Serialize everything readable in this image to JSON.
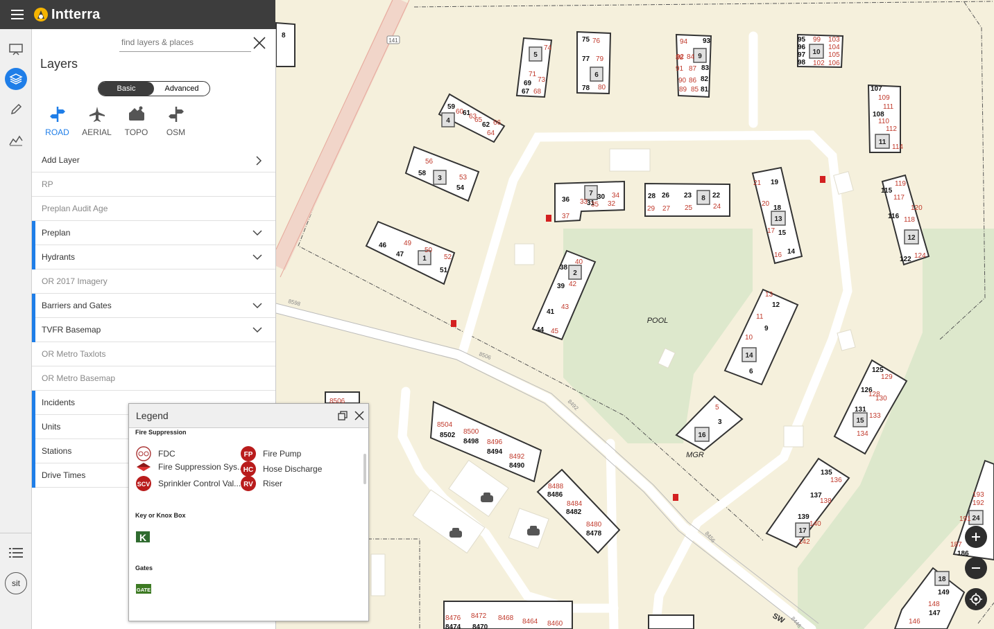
{
  "app": {
    "brand": "Intterra"
  },
  "rail": {
    "sit_label": "sit"
  },
  "panel": {
    "title": "Layers",
    "search_placeholder": "find layers & places",
    "modes": [
      "Basic",
      "Advanced"
    ],
    "basemaps": [
      {
        "label": "ROAD",
        "icon": "road-icon",
        "selected": true
      },
      {
        "label": "AERIAL",
        "icon": "airplane-icon",
        "selected": false
      },
      {
        "label": "TOPO",
        "icon": "topo-icon",
        "selected": false
      },
      {
        "label": "OSM",
        "icon": "osm-icon",
        "selected": false
      }
    ],
    "add_layer": "Add Layer",
    "layers": [
      {
        "label": "RP",
        "active": false,
        "expandable": false
      },
      {
        "label": "Preplan Audit Age",
        "active": false,
        "expandable": false
      },
      {
        "label": "Preplan",
        "active": true,
        "expandable": true
      },
      {
        "label": "Hydrants",
        "active": true,
        "expandable": true
      },
      {
        "label": "OR 2017 Imagery",
        "active": false,
        "expandable": false
      },
      {
        "label": "Barriers and Gates",
        "active": true,
        "expandable": true
      },
      {
        "label": "TVFR Basemap",
        "active": true,
        "expandable": true
      },
      {
        "label": "OR Metro Taxlots",
        "active": false,
        "expandable": false
      },
      {
        "label": "OR Metro Basemap",
        "active": false,
        "expandable": false
      },
      {
        "label": "Incidents",
        "active": true,
        "expandable": false
      },
      {
        "label": "Units",
        "active": true,
        "expandable": false
      },
      {
        "label": "Stations",
        "active": true,
        "expandable": false
      },
      {
        "label": "Drive Times",
        "active": true,
        "expandable": false
      }
    ]
  },
  "legend": {
    "title": "Legend",
    "fire_suppression": {
      "heading": "Fire Suppression",
      "items": [
        "FDC",
        "Fire Pump",
        "Fire Suppression Sys...",
        "Hose Discharge",
        "Sprinkler Control Val...",
        "Riser"
      ],
      "icon_text": [
        "FP",
        "HC",
        "SCV",
        "RV"
      ]
    },
    "knox": {
      "heading": "Key or Knox Box",
      "icon_text": "K"
    },
    "gates": {
      "heading": "Gates",
      "icon_text": "GATE"
    }
  },
  "map": {
    "pool_label": "POOL",
    "mgr_label": "MGR",
    "route_badge": "141",
    "road_labels": [
      "SW",
      "8598",
      "8506",
      "8492",
      "8456",
      "8446"
    ],
    "buildings": [
      {
        "id": "1",
        "units": [
          "46",
          "47",
          "49",
          "50",
          "51",
          "52"
        ]
      },
      {
        "id": "2",
        "units": [
          "38",
          "39",
          "40",
          "41",
          "42",
          "43",
          "44",
          "45"
        ]
      },
      {
        "id": "3",
        "units": [
          "53",
          "54",
          "56",
          "58"
        ]
      },
      {
        "id": "4",
        "units": [
          "59",
          "60",
          "61",
          "62",
          "63",
          "64",
          "65",
          "66"
        ]
      },
      {
        "id": "5",
        "units": [
          "67",
          "68",
          "69",
          "71",
          "73",
          "74"
        ]
      },
      {
        "id": "6",
        "units": [
          "75",
          "76",
          "77",
          "78",
          "79",
          "80"
        ]
      },
      {
        "id": "7",
        "units": [
          "30",
          "31",
          "32",
          "33",
          "34",
          "35",
          "36",
          "37"
        ]
      },
      {
        "id": "8",
        "units": [
          "22",
          "23",
          "24",
          "25",
          "26",
          "27",
          "28",
          "29"
        ]
      },
      {
        "id": "9",
        "units": [
          "81",
          "82",
          "83",
          "84",
          "85",
          "86",
          "87",
          "88",
          "89",
          "90",
          "91",
          "92",
          "93",
          "94"
        ]
      },
      {
        "id": "10",
        "units": [
          "95",
          "96",
          "97",
          "98",
          "99",
          "102",
          "103",
          "104",
          "105",
          "106"
        ]
      },
      {
        "id": "11",
        "units": [
          "107",
          "108",
          "109",
          "110",
          "111",
          "112",
          "114"
        ]
      },
      {
        "id": "12",
        "units": [
          "115",
          "116",
          "117",
          "118",
          "119",
          "120",
          "122",
          "124"
        ]
      },
      {
        "id": "13",
        "units": [
          "14",
          "15",
          "16",
          "17",
          "18",
          "19",
          "20",
          "21"
        ]
      },
      {
        "id": "14",
        "units": [
          "6",
          "9",
          "10",
          "11",
          "12",
          "13"
        ]
      },
      {
        "id": "15",
        "units": [
          "125",
          "126",
          "128",
          "129",
          "130",
          "131",
          "133",
          "134"
        ]
      },
      {
        "id": "16",
        "units": [
          "3",
          "5"
        ]
      },
      {
        "id": "17",
        "units": [
          "135",
          "136",
          "137",
          "138",
          "139",
          "140",
          "142"
        ]
      },
      {
        "id": "18",
        "units": [
          "146",
          "147",
          "148",
          "149"
        ]
      },
      {
        "id": "24",
        "units": [
          "186",
          "187",
          "191",
          "192",
          "193"
        ]
      }
    ],
    "addresses": [
      "8504",
      "8502",
      "8500",
      "8498",
      "8496",
      "8494",
      "8492",
      "8490",
      "8488",
      "8486",
      "8484",
      "8482",
      "8480",
      "8478",
      "8476",
      "8474",
      "8472",
      "8470",
      "8468",
      "8464",
      "8460",
      "8506",
      "8"
    ],
    "controls": [
      "zoom-in",
      "zoom-out",
      "locate"
    ]
  }
}
